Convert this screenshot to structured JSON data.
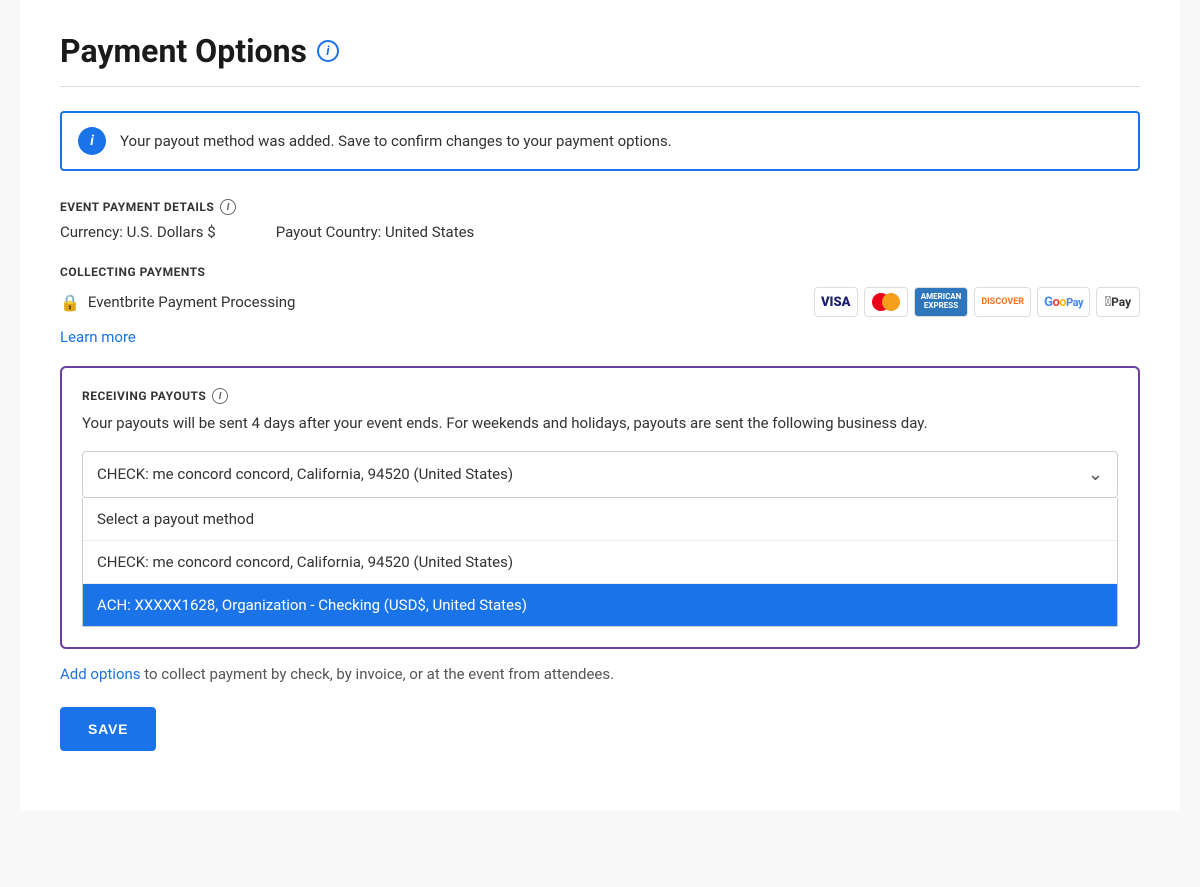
{
  "page": {
    "title": "Payment Options",
    "title_info_icon": "i"
  },
  "info_banner": {
    "icon": "i",
    "message": "Your payout method was added. Save to confirm changes to your payment options."
  },
  "event_payment": {
    "section_label": "EVENT PAYMENT DETAILS",
    "currency_label": "Currency: U.S. Dollars $",
    "payout_country_label": "Payout Country: United States"
  },
  "collecting_payments": {
    "section_label": "COLLECTING PAYMENTS",
    "processor_label": "Eventbrite Payment Processing",
    "learn_more": "Learn more",
    "cards": [
      {
        "id": "visa",
        "label": "VISA"
      },
      {
        "id": "mastercard",
        "label": "MC"
      },
      {
        "id": "amex",
        "label": "AMERICAN EXPRESS"
      },
      {
        "id": "discover",
        "label": "DISCOVER"
      },
      {
        "id": "gpay",
        "label": "G Pay"
      },
      {
        "id": "applepay",
        "label": "Apple Pay"
      }
    ]
  },
  "receiving_payouts": {
    "section_label": "RECEIVING PAYOUTS",
    "description": "Your payouts will be sent 4 days after your event ends. For weekends and holidays, payouts are sent the following business day.",
    "selected_value": "CHECK: me concord concord, California, 94520 (United States)",
    "dropdown_options": [
      {
        "value": "select_placeholder",
        "label": "Select a payout method",
        "active": false
      },
      {
        "value": "check",
        "label": "CHECK: me concord concord, California, 94520 (United States)",
        "active": false
      },
      {
        "value": "ach",
        "label": "ACH: XXXXX1628, Organization - Checking (USD$, United States)",
        "active": true
      }
    ]
  },
  "footer": {
    "add_options_prefix": "",
    "add_options_link": "Add options",
    "add_options_suffix": " to collect payment by check, by invoice, or at the event from attendees.",
    "save_button": "SAVE"
  }
}
